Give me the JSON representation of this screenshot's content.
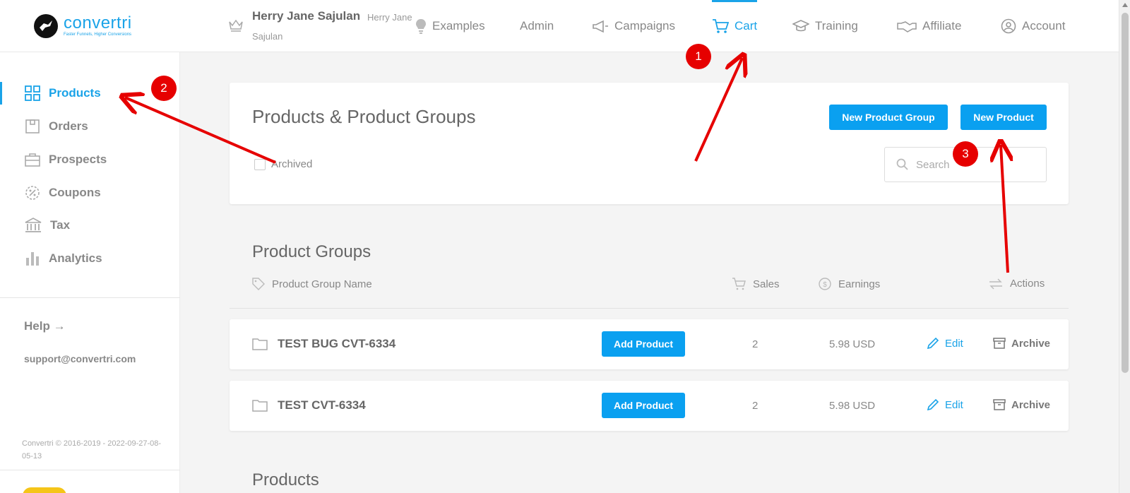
{
  "brand": {
    "name": "convertri",
    "tagline": "Faster Funnels, Higher Conversions"
  },
  "user": {
    "name": "Herry Jane Sajulan",
    "sub_line1": "Herry Jane",
    "sub_line2": "Sajulan"
  },
  "nav": [
    {
      "label": "Examples",
      "icon": "lightbulb-icon"
    },
    {
      "label": "Admin",
      "icon": ""
    },
    {
      "label": "Campaigns",
      "icon": "megaphone-icon"
    },
    {
      "label": "Cart",
      "icon": "cart-icon",
      "active": true
    },
    {
      "label": "Training",
      "icon": "graduation-cap-icon"
    },
    {
      "label": "Affiliate",
      "icon": "handshake-icon"
    },
    {
      "label": "Account",
      "icon": "user-circle-icon"
    }
  ],
  "sidebar": {
    "items": [
      {
        "label": "Products",
        "icon": "grid-icon",
        "active": true
      },
      {
        "label": "Orders",
        "icon": "box-icon"
      },
      {
        "label": "Prospects",
        "icon": "briefcase-icon"
      },
      {
        "label": "Coupons",
        "icon": "percent-badge-icon"
      },
      {
        "label": "Tax",
        "icon": "bank-icon"
      },
      {
        "label": "Analytics",
        "icon": "bar-chart-icon"
      }
    ],
    "help": "Help",
    "support_email": "support@convertri.com",
    "copyright": "Convertri © 2016-2019 - 2022-09-27-08-05-13"
  },
  "header": {
    "title": "Products & Product Groups",
    "new_group_label": "New Product Group",
    "new_product_label": "New Product",
    "archived_label": "Archived",
    "search_placeholder": "Search"
  },
  "product_groups": {
    "title": "Product Groups",
    "columns": {
      "name": "Product Group Name",
      "sales": "Sales",
      "earnings": "Earnings",
      "actions": "Actions"
    },
    "rows": [
      {
        "name": "TEST BUG CVT-6334",
        "add_label": "Add Product",
        "sales": "2",
        "earnings": "5.98 USD",
        "edit": "Edit",
        "archive": "Archive"
      },
      {
        "name": "TEST CVT-6334",
        "add_label": "Add Product",
        "sales": "2",
        "earnings": "5.98 USD",
        "edit": "Edit",
        "archive": "Archive"
      }
    ]
  },
  "products": {
    "title": "Products"
  },
  "annotations": {
    "badge1": "1",
    "badge2": "2",
    "badge3": "3"
  },
  "colors": {
    "accent": "#1aa3e8",
    "button": "#0aa0f0",
    "annotation": "#e60000",
    "background": "#f4f4f4"
  }
}
